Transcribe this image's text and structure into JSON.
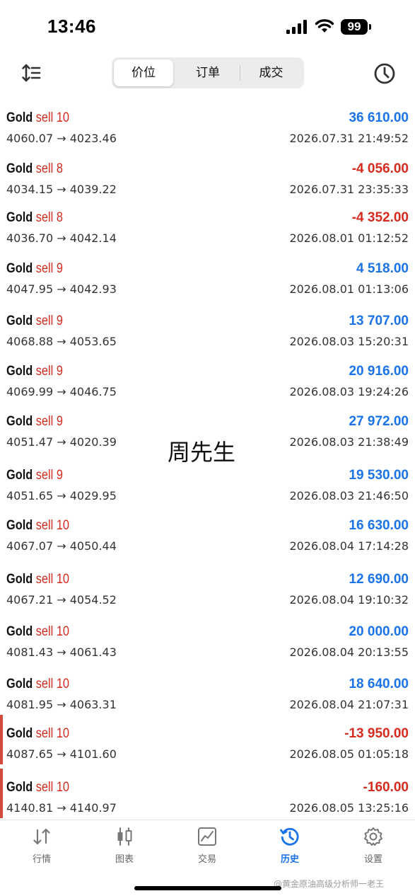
{
  "status": {
    "time": "13:46",
    "battery": "99"
  },
  "toolbar": {
    "tabs": [
      {
        "label": "价位"
      },
      {
        "label": "订单"
      },
      {
        "label": "成交"
      }
    ]
  },
  "trades": [
    {
      "symbol": "Gold",
      "type": "sell 10",
      "prices": "4060.07 → 4023.46",
      "profit": "36 610.00",
      "time": "2026.07.31 21:49:52"
    },
    {
      "symbol": "Gold",
      "type": "sell 8",
      "prices": "4034.15 → 4039.22",
      "profit": "-4 056.00",
      "time": "2026.07.31 23:35:33"
    },
    {
      "symbol": "Gold",
      "type": "sell 8",
      "prices": "4036.70 → 4042.14",
      "profit": "-4 352.00",
      "time": "2026.08.01 01:12:52"
    },
    {
      "symbol": "Gold",
      "type": "sell 9",
      "prices": "4047.95 → 4042.93",
      "profit": "4 518.00",
      "time": "2026.08.01 01:13:06"
    },
    {
      "symbol": "Gold",
      "type": "sell 9",
      "prices": "4068.88 → 4053.65",
      "profit": "13 707.00",
      "time": "2026.08.03 15:20:31"
    },
    {
      "symbol": "Gold",
      "type": "sell 9",
      "prices": "4069.99 → 4046.75",
      "profit": "20 916.00",
      "time": "2026.08.03 19:24:26"
    },
    {
      "symbol": "Gold",
      "type": "sell 9",
      "prices": "4051.47 → 4020.39",
      "profit": "27 972.00",
      "time": "2026.08.03 21:38:49"
    },
    {
      "symbol": "Gold",
      "type": "sell 9",
      "prices": "4051.65 → 4029.95",
      "profit": "19 530.00",
      "time": "2026.08.03 21:46:50"
    },
    {
      "symbol": "Gold",
      "type": "sell 10",
      "prices": "4067.07 → 4050.44",
      "profit": "16 630.00",
      "time": "2026.08.04 17:14:28"
    },
    {
      "symbol": "Gold",
      "type": "sell 10",
      "prices": "4067.21 → 4054.52",
      "profit": "12 690.00",
      "time": "2026.08.04 19:10:32"
    },
    {
      "symbol": "Gold",
      "type": "sell 10",
      "prices": "4081.43 → 4061.43",
      "profit": "20 000.00",
      "time": "2026.08.04 20:13:55"
    },
    {
      "symbol": "Gold",
      "type": "sell 10",
      "prices": "4081.95 → 4063.31",
      "profit": "18 640.00",
      "time": "2026.08.04 21:07:31"
    },
    {
      "symbol": "Gold",
      "type": "sell 10",
      "prices": "4087.65 → 4101.60",
      "profit": "-13 950.00",
      "time": "2026.08.05 01:05:18"
    },
    {
      "symbol": "Gold",
      "type": "sell 10",
      "prices": "4140.81 → 4140.97",
      "profit": "-160.00",
      "time": "2026.08.05 13:25:16"
    }
  ],
  "watermark": "周先生",
  "tabbar": {
    "items": [
      {
        "label": "行情",
        "icon": "arrows-updown-icon"
      },
      {
        "label": "图表",
        "icon": "candlestick-icon"
      },
      {
        "label": "交易",
        "icon": "line-chart-icon"
      },
      {
        "label": "历史",
        "icon": "history-clock-icon"
      },
      {
        "label": "设置",
        "icon": "gear-icon"
      }
    ]
  },
  "credit": "@黄金原油高级分析师一老王",
  "colors": {
    "profit_positive": "#1a73e8",
    "profit_negative": "#d52b1e",
    "sell": "#d52b1e",
    "accent_active_tab": "#1a73e8"
  }
}
